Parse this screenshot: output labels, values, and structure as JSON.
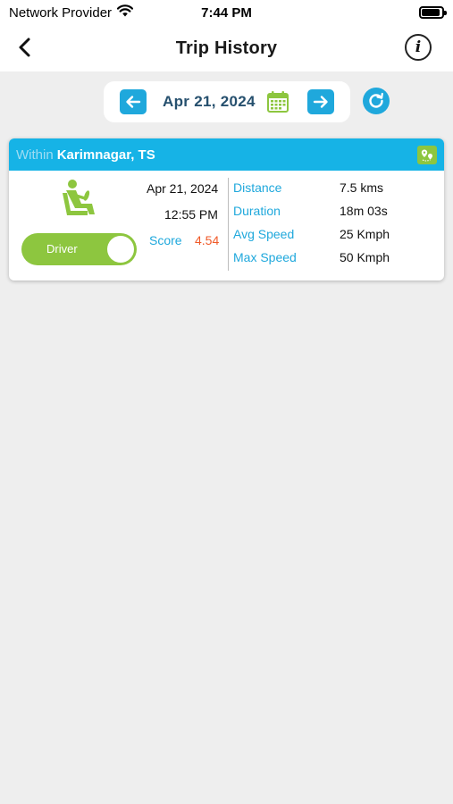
{
  "status_bar": {
    "carrier": "Network Provider",
    "time": "7:44 PM",
    "battery_level": 0.9
  },
  "header": {
    "title": "Trip History",
    "back_icon": "chevron-left-icon",
    "info_icon": "info-icon",
    "info_glyph": "i"
  },
  "date_selector": {
    "date": "Apr 21, 2024",
    "prev_icon": "arrow-left-icon",
    "next_icon": "arrow-right-icon",
    "calendar_icon": "calendar-icon",
    "refresh_icon": "refresh-icon"
  },
  "trip": {
    "within_label": "Within",
    "location": "Karimnagar, TS",
    "map_icon": "map-pin-icon",
    "date": "Apr 21, 2024",
    "time": "12:55 PM",
    "score_label": "Score",
    "score": "4.54",
    "role_toggle_label": "Driver",
    "role_toggle_on": true,
    "stats": [
      {
        "label": "Distance",
        "value": "7.5 kms"
      },
      {
        "label": "Duration",
        "value": "18m 03s"
      },
      {
        "label": "Avg Speed",
        "value": "25 Kmph"
      },
      {
        "label": "Max Speed",
        "value": "50 Kmph"
      }
    ]
  },
  "colors": {
    "accent_blue": "#1fa8dc",
    "accent_green": "#8dc63f",
    "score_orange": "#f05a28",
    "date_text": "#26506e",
    "background": "#eeeeee"
  }
}
